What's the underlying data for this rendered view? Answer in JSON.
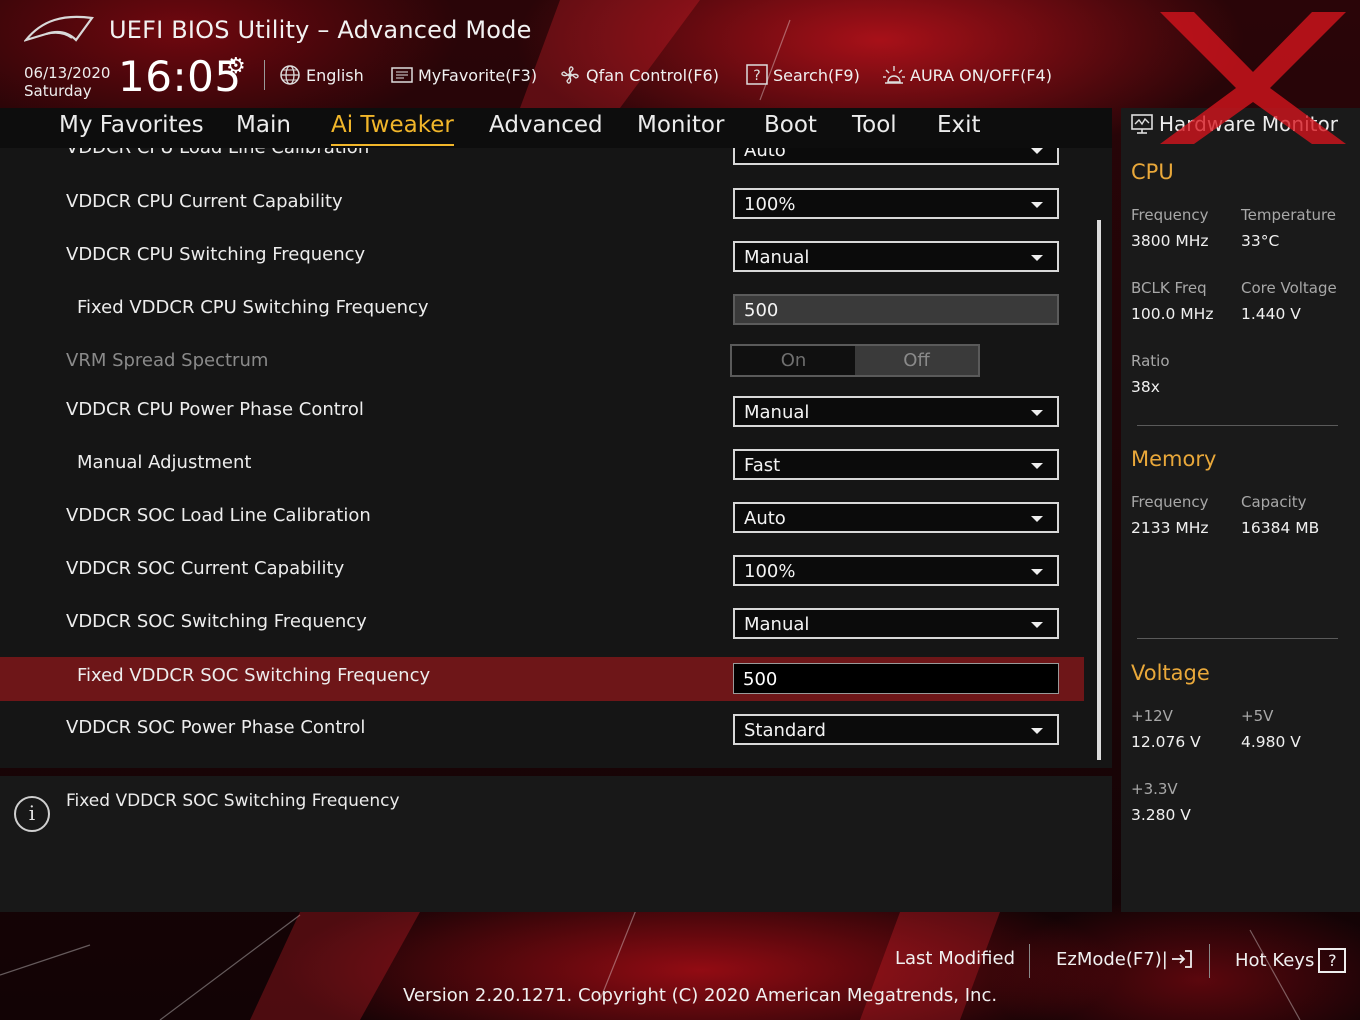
{
  "header": {
    "title": "UEFI BIOS Utility – Advanced Mode",
    "date": "06/13/2020",
    "day": "Saturday",
    "time": "16:05",
    "items": [
      {
        "label": "English",
        "icon": "globe-icon"
      },
      {
        "label": "MyFavorite(F3)",
        "icon": "favorite-list-icon"
      },
      {
        "label": "Qfan Control(F6)",
        "icon": "fan-icon"
      },
      {
        "label": "Search(F9)",
        "icon": "search-help-icon"
      },
      {
        "label": "AURA ON/OFF(F4)",
        "icon": "aura-light-icon"
      }
    ]
  },
  "tabs": [
    {
      "label": "My Favorites"
    },
    {
      "label": "Main"
    },
    {
      "label": "Ai Tweaker",
      "active": true
    },
    {
      "label": "Advanced"
    },
    {
      "label": "Monitor"
    },
    {
      "label": "Boot"
    },
    {
      "label": "Tool"
    },
    {
      "label": "Exit"
    }
  ],
  "rows": [
    {
      "label": "VDDCR CPU Load Line Calibration",
      "type": "select",
      "value": "Auto"
    },
    {
      "label": "VDDCR CPU Current Capability",
      "type": "select",
      "value": "100%"
    },
    {
      "label": "VDDCR CPU Switching Frequency",
      "type": "select",
      "value": "Manual"
    },
    {
      "label": "Fixed VDDCR CPU Switching Frequency",
      "type": "input-disabled",
      "value": "500"
    },
    {
      "label": "VRM Spread Spectrum",
      "type": "toggle",
      "on": "On",
      "off": "Off"
    },
    {
      "label": "VDDCR CPU Power Phase Control",
      "type": "select",
      "value": "Manual"
    },
    {
      "label": "Manual Adjustment",
      "type": "select",
      "value": "Fast"
    },
    {
      "label": "VDDCR SOC Load Line Calibration",
      "type": "select",
      "value": "Auto"
    },
    {
      "label": "VDDCR SOC Current Capability",
      "type": "select",
      "value": "100%"
    },
    {
      "label": "VDDCR SOC Switching Frequency",
      "type": "select",
      "value": "Manual"
    },
    {
      "label": "Fixed VDDCR SOC Switching Frequency",
      "type": "input",
      "value": "500"
    },
    {
      "label": "VDDCR SOC Power Phase Control",
      "type": "select",
      "value": "Standard"
    }
  ],
  "info": {
    "text": "Fixed VDDCR SOC Switching Frequency"
  },
  "hardware_monitor": {
    "title": "Hardware Monitor",
    "cpu": {
      "title": "CPU",
      "frequency_label": "Frequency",
      "frequency": "3800 MHz",
      "temperature_label": "Temperature",
      "temperature": "33°C",
      "bclk_label": "BCLK Freq",
      "bclk": "100.0 MHz",
      "core_voltage_label": "Core Voltage",
      "core_voltage": "1.440 V",
      "ratio_label": "Ratio",
      "ratio": "38x"
    },
    "memory": {
      "title": "Memory",
      "frequency_label": "Frequency",
      "frequency": "2133 MHz",
      "capacity_label": "Capacity",
      "capacity": "16384 MB"
    },
    "voltage": {
      "title": "Voltage",
      "v12_label": "+12V",
      "v12": "12.076 V",
      "v5_label": "+5V",
      "v5": "4.980 V",
      "v33_label": "+3.3V",
      "v33": "3.280 V"
    }
  },
  "footer": {
    "last_modified": "Last Modified",
    "ezmode": "EzMode(F7)|",
    "hotkeys": "Hot Keys",
    "hotkeys_key": "?",
    "copyright": "Version 2.20.1271. Copyright (C) 2020 American Megatrends, Inc."
  },
  "colors": {
    "accent": "#f1b62a",
    "section": "#e9a83a",
    "selected_row": "#6e1618"
  }
}
